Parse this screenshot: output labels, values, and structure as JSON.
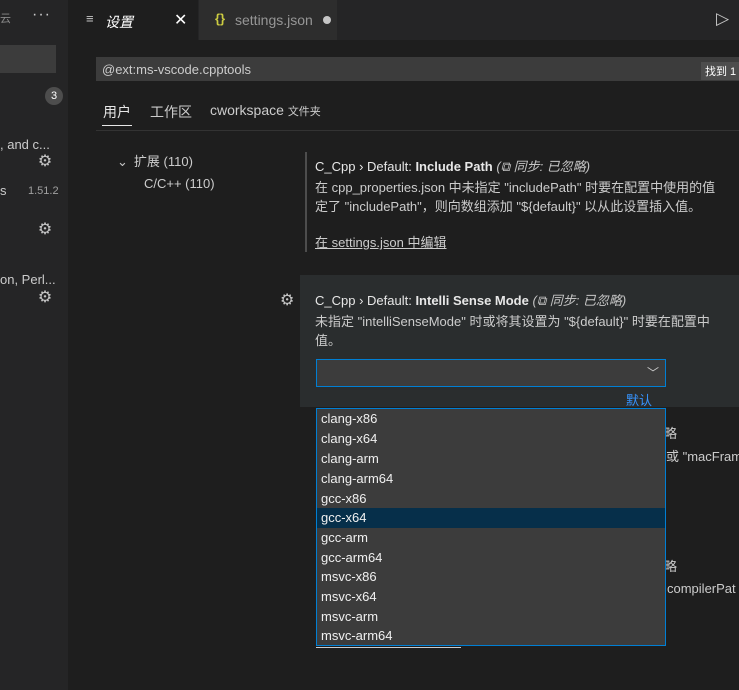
{
  "sidebar": {
    "title_fragment": "云",
    "badge": "3",
    "item1_text": ", and c...",
    "item2_text": "s",
    "item2_version": "1.51.2",
    "item3_text": "on, Perl..."
  },
  "tabs": [
    {
      "label": "设置",
      "icon": "settings-lines-icon"
    },
    {
      "label": "settings.json",
      "icon": "json-braces-icon"
    }
  ],
  "search": {
    "value": "@ext:ms-vscode.cpptools",
    "count": "找到 1"
  },
  "scopes": {
    "user": "用户",
    "workspace": "工作区",
    "folder": "cworkspace",
    "folder_suffix": "文件夹"
  },
  "toc": [
    {
      "label": "扩展 (110)"
    },
    {
      "label": "C/C++ (110)"
    }
  ],
  "setting1": {
    "category": "C_Cpp › Default: ",
    "name": "Include Path",
    "sync": "(⧉ 同步: 已忽略)",
    "desc_line1": "在 cpp_properties.json 中未指定 \"includePath\" 时要在配置中使用的值",
    "desc_line2": "定了 \"includePath\"，则向数组添加 \"${default}\" 以从此设置插入值。",
    "edit_link": "在 settings.json 中编辑"
  },
  "setting2": {
    "category": "C_Cpp › Default: ",
    "name": "Intelli Sense Mode",
    "sync": "(⧉ 同步: 已忽略)",
    "desc_line1": "未指定 \"intelliSenseMode\" 时或将其设置为 \"${default}\" 时要在配置中",
    "desc_line2": "值。",
    "select_value": "",
    "default_label": "默认"
  },
  "dropdown": {
    "options": [
      "clang-x86",
      "clang-x64",
      "clang-arm",
      "clang-arm64",
      "gcc-x86",
      "gcc-x64",
      "gcc-arm",
      "gcc-arm64",
      "msvc-x86",
      "msvc-x64",
      "msvc-arm",
      "msvc-arm64"
    ],
    "selected": "gcc-x64"
  },
  "background_fragments": {
    "frag1": "略",
    "frag2": "或 \"macFram",
    "frag3": "略",
    "frag4": "compilerPat"
  },
  "colors": {
    "accent": "#007fd4",
    "link": "#3794ff",
    "selected_option": "#062f4a"
  }
}
